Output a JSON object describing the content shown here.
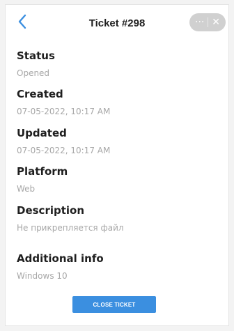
{
  "header": {
    "title": "Ticket #298",
    "capsule_more": "···",
    "capsule_close": "✕"
  },
  "fields": {
    "status": {
      "label": "Status",
      "value": "Opened"
    },
    "created": {
      "label": "Created",
      "value": "07-05-2022, 10:17 AM"
    },
    "updated": {
      "label": "Updated",
      "value": "07-05-2022, 10:17 AM"
    },
    "platform": {
      "label": "Platform",
      "value": "Web"
    },
    "description": {
      "label": "Description",
      "value": "Не прикрепляется файл"
    },
    "additional_info": {
      "label": "Additional info",
      "value": "Windows 10"
    }
  },
  "actions": {
    "close_ticket_label": "CLOSE TICKET"
  },
  "colors": {
    "accent": "#3b8fe0",
    "value_text": "#a7a7a7",
    "label_text": "#1f1f1f"
  }
}
